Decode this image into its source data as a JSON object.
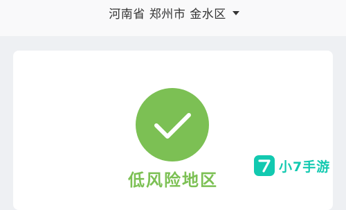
{
  "header": {
    "province": "河南省",
    "city": "郑州市",
    "district": "金水区",
    "dropdown_icon": "caret-down-icon"
  },
  "status": {
    "icon": "check-circle-icon",
    "label": "低风险地区",
    "color": "#7cc054"
  },
  "watermark": {
    "logo_icon": "seven-logo-icon",
    "text": "小7手游",
    "color": "#12c9b0"
  }
}
